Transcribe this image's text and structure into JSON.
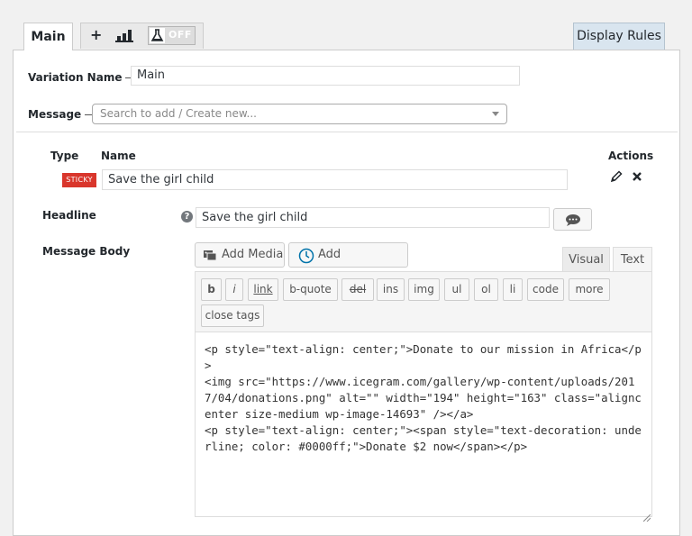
{
  "tabs": {
    "main_label": "Main",
    "add_label": "+",
    "toggle_label": "OFF",
    "display_rules_label": "Display Rules"
  },
  "form": {
    "variation_name_label": "Variation Name",
    "variation_name_value": "Main",
    "message_label": "Message",
    "message_placeholder": "Search to add / Create new..."
  },
  "table": {
    "type_header": "Type",
    "name_header": "Name",
    "actions_header": "Actions",
    "row": {
      "type_badge": "STICKY",
      "name_value": "Save the girl child"
    }
  },
  "headline": {
    "label": "Headline",
    "value": "Save the girl child",
    "help": "?"
  },
  "message_body": {
    "label": "Message Body",
    "add_media": "Add Media",
    "add_countdown": "Add Countdown",
    "tab_visual": "Visual",
    "tab_text": "Text",
    "quicktags": [
      "b",
      "i",
      "link",
      "b-quote",
      "del",
      "ins",
      "img",
      "ul",
      "ol",
      "li",
      "code",
      "more",
      "close tags"
    ],
    "content": "<p style=\"text-align: center;\">Donate to our mission in Africa</p>\n<img src=\"https://www.icegram.com/gallery/wp-content/uploads/2017/04/donations.png\" alt=\"\" width=\"194\" height=\"163\" class=\"aligncenter size-medium wp-image-14693\" /></a>\n<p style=\"text-align: center;\"><span style=\"text-decoration: underline; color: #0000ff;\">Donate $2 now</span></p>"
  },
  "colors": {
    "sticky_badge": "#d9362c",
    "display_rules_bg": "#d9e5ef",
    "accent_icon": "#0073aa"
  }
}
